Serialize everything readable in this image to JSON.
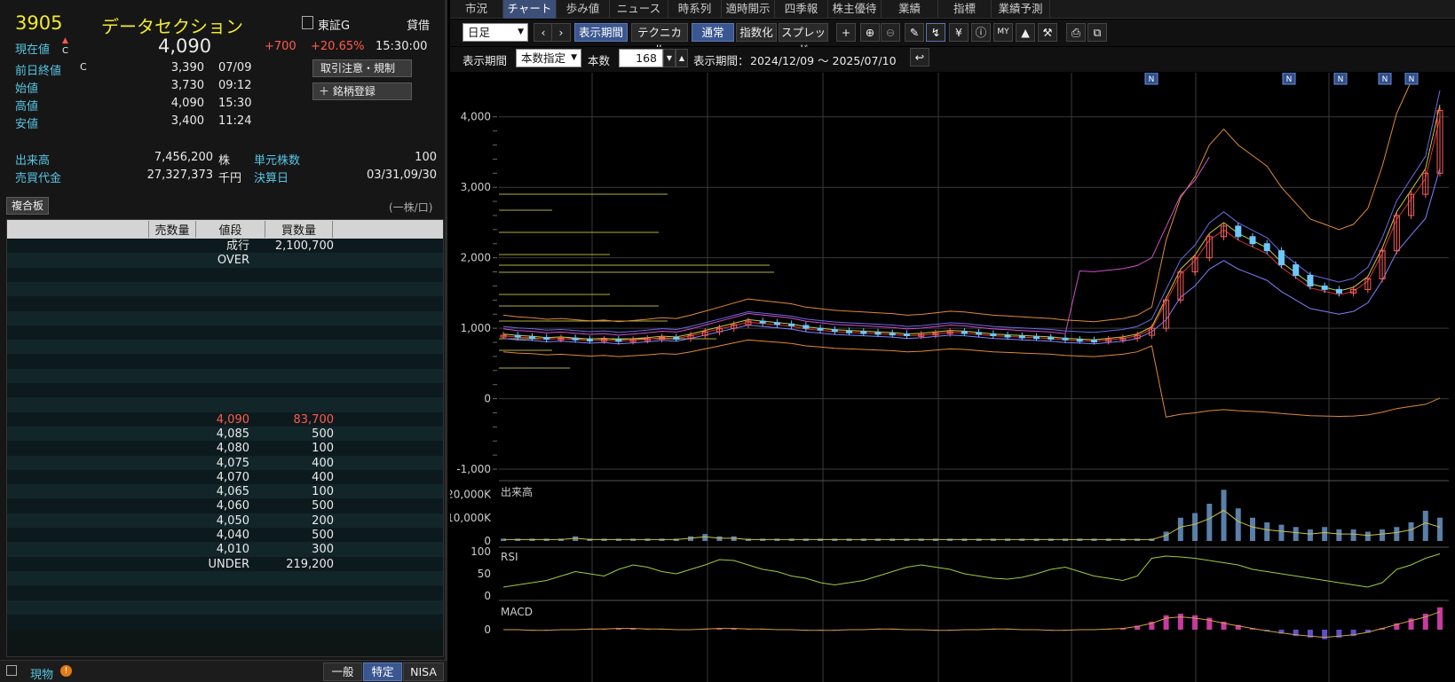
{
  "stock": {
    "code": "3905",
    "name": "データセクション",
    "market_icon": "document-icon",
    "market": "東証G",
    "margin": "貸借",
    "price_label": "現在値",
    "price_mark": "C",
    "price": "4,090",
    "change": "+700",
    "change_pct": "+20.65%",
    "time": "15:30:00"
  },
  "quotes": [
    {
      "label": "前日終値",
      "mark": "C",
      "value": "3,390",
      "time": "07/09"
    },
    {
      "label": "始値",
      "mark": "",
      "value": "3,730",
      "time": "09:12"
    },
    {
      "label": "高値",
      "mark": "",
      "value": "4,090",
      "time": "15:30"
    },
    {
      "label": "安値",
      "mark": "",
      "value": "3,400",
      "time": "11:24"
    }
  ],
  "buttons": {
    "caution": "取引注意・規制",
    "register": "銘柄登録"
  },
  "volume": {
    "label": "出来高",
    "value": "7,456,200",
    "unit": "株"
  },
  "turnover": {
    "label": "売買代金",
    "value": "27,327,373",
    "unit": "千円"
  },
  "unit_shares": {
    "label": "単元株数",
    "value": "100"
  },
  "settlement": {
    "label": "決算日",
    "value": "03/31,09/30"
  },
  "board": {
    "tab": "複合板",
    "unit_note": "(一株/口)",
    "headers": {
      "sell": "売数量",
      "price": "値段",
      "buy": "買数量"
    },
    "market_row": {
      "price": "成行",
      "qty": "2,100,700"
    },
    "over": "OVER",
    "rows": [
      {
        "price": "4,090",
        "qty": "83,700"
      },
      {
        "price": "4,085",
        "qty": "500"
      },
      {
        "price": "4,080",
        "qty": "100"
      },
      {
        "price": "4,075",
        "qty": "400"
      },
      {
        "price": "4,070",
        "qty": "400"
      },
      {
        "price": "4,065",
        "qty": "100"
      },
      {
        "price": "4,060",
        "qty": "500"
      },
      {
        "price": "4,050",
        "qty": "200"
      },
      {
        "price": "4,040",
        "qty": "500"
      },
      {
        "price": "4,010",
        "qty": "300"
      }
    ],
    "under": {
      "label": "UNDER",
      "qty": "219,200"
    }
  },
  "bottom": {
    "label": "現物",
    "tabs": [
      "一般",
      "特定",
      "NISA"
    ]
  },
  "tabs": [
    "市況",
    "チャート",
    "歩み値",
    "ニュース",
    "時系列",
    "適時開示",
    "四季報",
    "株主優待",
    "業績",
    "指標",
    "業績予測"
  ],
  "toolbar": {
    "period_select": "日足",
    "display_period": "表示期間",
    "technical": "テクニカル",
    "normal": "通常",
    "index": "指数化",
    "spread": "スプレッド",
    "range_label": "表示期間",
    "range_select": "本数指定",
    "count_label": "本数",
    "count": "168",
    "range_text_label": "表示期間：",
    "range_text": "2024/12/09 ～ 2025/07/10"
  },
  "chart_data": {
    "type": "line",
    "price_axis": {
      "ticks": [
        "4,000",
        "3,000",
        "2,000",
        "1,000",
        "0",
        "-1,000"
      ],
      "values": [
        4000,
        3000,
        2000,
        1000,
        0,
        -1000
      ]
    },
    "close": [
      900,
      880,
      870,
      850,
      860,
      845,
      830,
      840,
      820,
      835,
      850,
      870,
      860,
      900,
      950,
      1000,
      1050,
      1100,
      1080,
      1060,
      1040,
      1000,
      980,
      960,
      950,
      940,
      930,
      920,
      900,
      910,
      930,
      950,
      940,
      920,
      900,
      890,
      880,
      870,
      860,
      840,
      830,
      820,
      840,
      860,
      900,
      1000,
      1400,
      1800,
      2000,
      2300,
      2450,
      2300,
      2200,
      2100,
      1900,
      1750,
      1600,
      1550,
      1500,
      1550,
      1700,
      2100,
      2600,
      2900,
      3200,
      4090
    ],
    "news_markers": 5,
    "volume_label": "出来高",
    "volume_ticks": [
      "20,000K",
      "10,000K",
      "0"
    ],
    "volume": [
      1,
      1,
      1,
      1,
      1,
      2,
      1,
      1,
      1,
      1,
      1,
      1,
      1,
      2,
      3,
      2,
      2,
      1,
      1,
      1,
      1,
      1,
      1,
      1,
      1,
      1,
      1,
      1,
      1,
      1,
      1,
      1,
      1,
      1,
      1,
      1,
      1,
      1,
      1,
      1,
      1,
      1,
      1,
      1,
      1,
      1,
      4,
      10,
      12,
      16,
      22,
      14,
      10,
      8,
      7,
      6,
      5,
      6,
      5,
      5,
      4,
      5,
      6,
      8,
      13,
      10
    ],
    "rsi_label": "RSI",
    "rsi_ticks": [
      "100",
      "50",
      "0"
    ],
    "rsi": [
      20,
      25,
      30,
      35,
      45,
      55,
      50,
      45,
      60,
      70,
      65,
      55,
      50,
      60,
      70,
      82,
      80,
      70,
      60,
      55,
      45,
      40,
      30,
      25,
      30,
      35,
      45,
      55,
      65,
      70,
      65,
      60,
      50,
      45,
      40,
      38,
      42,
      50,
      60,
      65,
      55,
      45,
      40,
      35,
      45,
      85,
      90,
      88,
      85,
      80,
      75,
      70,
      60,
      55,
      50,
      45,
      40,
      35,
      30,
      25,
      20,
      30,
      60,
      70,
      85,
      95
    ],
    "macd_label": "MACD",
    "macd_ticks": [
      "0"
    ],
    "macd": [
      0,
      0,
      -1,
      -1,
      0,
      0,
      1,
      1,
      2,
      2,
      1,
      1,
      0,
      0,
      1,
      2,
      2,
      1,
      1,
      0,
      0,
      -1,
      -1,
      -1,
      0,
      0,
      1,
      1,
      0,
      0,
      -1,
      -1,
      0,
      0,
      1,
      1,
      0,
      0,
      -1,
      -1,
      0,
      0,
      1,
      2,
      5,
      10,
      18,
      20,
      18,
      15,
      10,
      6,
      2,
      -2,
      -5,
      -8,
      -10,
      -12,
      -10,
      -8,
      -4,
      2,
      8,
      14,
      20,
      28
    ]
  }
}
